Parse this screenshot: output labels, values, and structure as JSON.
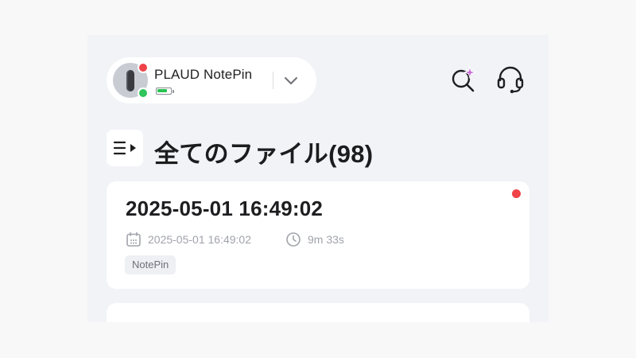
{
  "device": {
    "name": "PLAUD NotePin",
    "battery_level": 0.85,
    "status_colors": {
      "alert": "#ef4347",
      "connected": "#2fc45c"
    }
  },
  "header_icons": [
    "ai-search-icon",
    "headset-icon"
  ],
  "page": {
    "title": "全てのファイル(98)"
  },
  "files": [
    {
      "title": "2025-05-01 16:49:02",
      "date": "2025-05-01 16:49:02",
      "duration": "9m 33s",
      "tag": "NotePin",
      "unread": true
    }
  ],
  "colors": {
    "background": "#f2f3f7",
    "card": "#ffffff",
    "accent_sparkle": "#c86dd7",
    "unread": "#ef4347",
    "battery": "#28c350"
  }
}
